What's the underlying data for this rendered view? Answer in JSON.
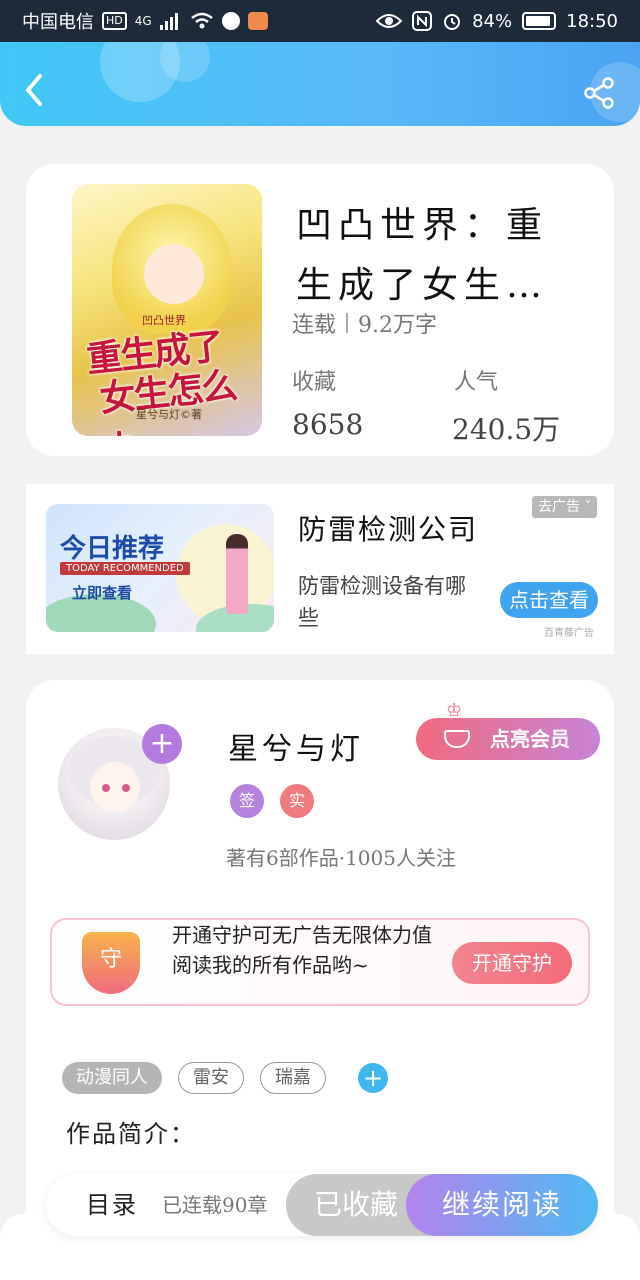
{
  "status_bar": {
    "carrier": "中国电信",
    "hd": "HD",
    "network": "4G",
    "battery": "84%",
    "time": "18:50"
  },
  "book": {
    "title": "凹凸世界：重生成了女生…",
    "status": "连载",
    "word_count": "9.2万字",
    "collect_label": "收藏",
    "collect_value": "8658",
    "popularity_label": "人气",
    "popularity_value": "240.5万",
    "cover": {
      "series": "凹凸世界",
      "title_line1": "重生成了",
      "title_line2": "女生怎么办",
      "author": "星兮与灯©著"
    }
  },
  "ad": {
    "image_title": "今日推荐",
    "image_subtitle": "TODAY RECOMMENDED",
    "image_button": "立即查看",
    "remove_label": "去广告",
    "headline": "防雷检测公司",
    "description": "防雷检测设备有哪些",
    "cta": "点击查看",
    "source": "百青藤广告"
  },
  "author": {
    "name": "星兮与灯",
    "badge1": "签",
    "badge2": "实",
    "vip_label": "点亮会员",
    "stats": "著有6部作品·1005人关注",
    "guard_text": "开通守护可无广告无限体力值阅读我的所有作品哟~",
    "guard_shield": "守",
    "guard_button": "开通守护"
  },
  "tags": [
    "动漫同人",
    "雷安",
    "瑞嘉"
  ],
  "intro_label": "作品简介：",
  "bottom": {
    "catalog": "目录",
    "chapters": "已连载90章",
    "collected": "已收藏",
    "read": "继续阅读"
  },
  "colors": {
    "header_start": "#3fc8f6",
    "header_end": "#4aa4f2",
    "vip_gradient_start": "#f06b7e",
    "read_gradient_start": "#b483ee",
    "read_gradient_end": "#4fbaf2"
  }
}
